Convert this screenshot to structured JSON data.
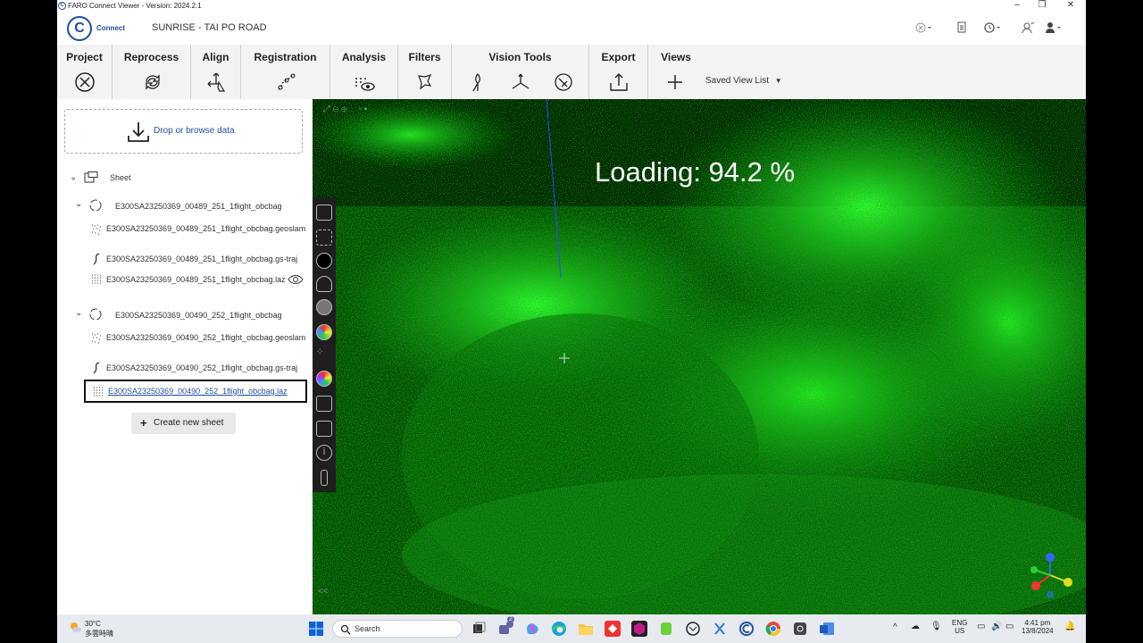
{
  "window": {
    "title": "FARO Connect Viewer - Version: 2024.2.1"
  },
  "header": {
    "brand": "Connect",
    "project_name": "SUNRISE - TAI PO ROAD"
  },
  "ribbon": {
    "groups": [
      {
        "title": "Project"
      },
      {
        "title": "Reprocess"
      },
      {
        "title": "Align"
      },
      {
        "title": "Registration"
      },
      {
        "title": "Analysis"
      },
      {
        "title": "Filters"
      },
      {
        "title": "Vision Tools"
      },
      {
        "title": "Export"
      },
      {
        "title": "Views"
      }
    ],
    "saved_view_list": "Saved View List"
  },
  "panel": {
    "drop_label": "Drop or browse data",
    "sheet_label": "Sheet",
    "tree": [
      {
        "label": "E300SA23250369_00489_251_1flight_obcbag"
      },
      {
        "label": "E300SA23250369_00489_251_1flight_obcbag.geoslam"
      },
      {
        "label": "E300SA23250369_00489_251_1flight_obcbag.gs-traj"
      },
      {
        "label": "E300SA23250369_00489_251_1flight_obcbag.laz"
      },
      {
        "label": "E300SA23250369_00490_252_1flight_obcbag"
      },
      {
        "label": "E300SA23250369_00490_252_1flight_obcbag.geoslam"
      },
      {
        "label": "E300SA23250369_00490_252_1flight_obcbag.gs-traj"
      },
      {
        "label": "E300SA23250369_00490_252_1flight_obcbag.laz"
      }
    ],
    "create_sheet": "Create new sheet"
  },
  "viewport": {
    "loading_text": "Loading: 94.2 %",
    "loading_progress": 94.2
  },
  "taskbar": {
    "weather_temp": "30°C",
    "weather_desc": "多雲時晴",
    "search_label": "Search",
    "chat_badge": "2",
    "lang_top": "ENG",
    "lang_bottom": "US",
    "time": "4:41 pm",
    "date": "13/8/2024"
  },
  "colors": {
    "accent": "#1f4f9c",
    "pointcloud": "#22cc22",
    "ribbon_bg": "#f3f3f3"
  }
}
